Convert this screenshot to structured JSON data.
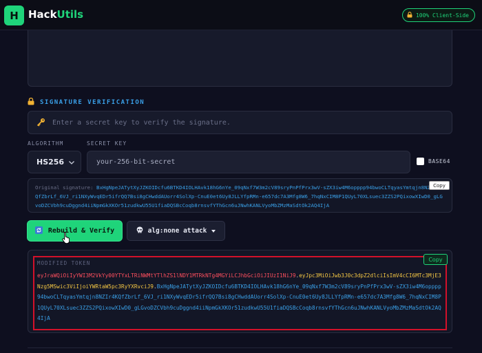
{
  "header": {
    "logo_letter": "H",
    "brand_main": "Hack",
    "brand_accent": "Utils",
    "badge_text": "100% Client-Side"
  },
  "signature": {
    "section_title": "SIGNATURE VERIFICATION",
    "secret_placeholder": "Enter a secret key to verify the signature.",
    "algorithm_label": "ALGORITHM",
    "algorithm_value": "HS256",
    "secret_key_label": "SECRET KEY",
    "secret_key_value": "your-256-bit-secret",
    "base64_label": "BASE64",
    "original_label": "Original signature:",
    "original_signature": "BxHgNpeJATytXyJZKOIDcfu6BTKD4IOLHAvk18hG6nYe_09qNxf7W3m2cV89sryPnPfPrx3wV-sZX3iw4M6opppp94bwoCLTqyasYmtqjn8NZIr4KQfZbrLf_6VJ_ri1NXyWvqEDr5ifrQQ7Bsi8gCHwddAUorr4SolXp-CnuE0et6Uy8JLLYfpRMn-e657dc7A3Mfg8W6_7hqNxCIM8P1QUyL70XLsuec3ZZS2PQixowXIwD0_gLGvoDZCVbh9cuDggnd4iiNpmGkXKOr51zudkwU55U1fiaDQSBcCoqb8rnsvfYThGcn6uJNwhKANLVyoMbZMzMaSdtOk2AQ4IjA",
    "copy_label": "Copy"
  },
  "actions": {
    "rebuild_label": "Rebuild & Verify",
    "alg_none_label": "alg:none attack"
  },
  "modified": {
    "label": "MODIFIED TOKEN",
    "copy_label": "Copy",
    "header_part": "eyJraWQiOiIyYWI3M2VkYy00YTYxLTRiNWMtYTlhZS1lNDY1MTRkNTg4MGYiLCJhbGciOiJIUzI1NiJ9",
    "dot1": ".",
    "payload_part": "eyJpc3MiOiJwb3J0c3dpZ2dlciIsImV4cCI6MTc3MjE3Nzg5MSwic3ViIjoiYWRtaW5pc3RyYXRvciJ9",
    "dot2": ".",
    "signature_part": "BxHgNpeJATytXyJZKOIDcfu6BTKD4IOLHAvk18hG6nYe_09qNxf7W3m2cV89sryPnPfPrx3wV-sZX3iw4M6opppp94bwoCLTqyasYmtqjn8NZIr4KQfZbrLf_6VJ_ri1NXyWvqEDr5ifrQQ7Bsi8gCHwddAUorr4SolXp-CnuE0et6Uy8JLLYfpRMn-e657dc7A3Mfg8W6_7hqNxCIM8P1QUyL70XLsuec3ZZS2PQixowXIwD0_gLGvoDZCVbh9cuDggnd4iiNpmGkXKOr51zudkwU55U1fiaDQSBcCoqb8rnsvfYThGcn6uJNwhKANLVyoMbZMzMaSdtOk2AQ4IjA"
  },
  "colors": {
    "accent_green": "#1fd47a",
    "accent_blue": "#3aa0e8",
    "token_header": "#ff4f5e",
    "token_payload": "#f6c844",
    "highlight_border": "#d4112a"
  },
  "icons": {
    "badge": "lock-icon",
    "section": "lock-icon",
    "secret_input": "key-icon",
    "rebuild": "refresh-icon",
    "alg_none": "skull-icon",
    "alg_dropdown": "chevron-down-icon"
  }
}
